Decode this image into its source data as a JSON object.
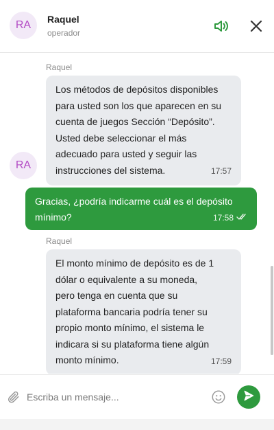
{
  "header": {
    "avatar_initials": "RA",
    "name": "Raquel",
    "role": "operador",
    "sound_icon": "speaker-volume-icon",
    "close_icon": "close-icon"
  },
  "messages": [
    {
      "direction": "incoming",
      "sender": "Raquel",
      "lines": [
        "Los métodos de depósitos disponibles",
        "para usted son los que aparecen en su",
        "cuenta de juegos Sección “Depósito”.",
        "Usted debe seleccionar el más",
        "adecuado para usted y seguir las",
        "instrucciones del sistema."
      ],
      "time": "17:57",
      "avatar_initials": "RA"
    },
    {
      "direction": "outgoing",
      "lines": [
        "Gracias, ¿podría indicarme cuál es el depósito",
        "mínimo?"
      ],
      "time": "17:58",
      "status_icon": "double-check-icon"
    },
    {
      "direction": "incoming",
      "sender": "Raquel",
      "lines": [
        "El monto mínimo de depósito es de 1",
        "dólar o equivalente a su moneda,",
        "pero tenga en cuenta que su",
        "plataforma bancaria podría tener su",
        "propio monto mínimo, el sistema le",
        "indicara si su plataforma tiene algún",
        "monto mínimo."
      ],
      "time": "17:59"
    }
  ],
  "composer": {
    "placeholder": "Escriba un mensaje...",
    "attach_icon": "paperclip-icon",
    "emoji_icon": "smiley-icon",
    "send_icon": "send-icon"
  },
  "colors": {
    "accent": "#2e9a3e",
    "avatar_bg": "#f2e9f7",
    "avatar_text": "#b34bc4",
    "incoming_bubble": "#e9ebee"
  }
}
